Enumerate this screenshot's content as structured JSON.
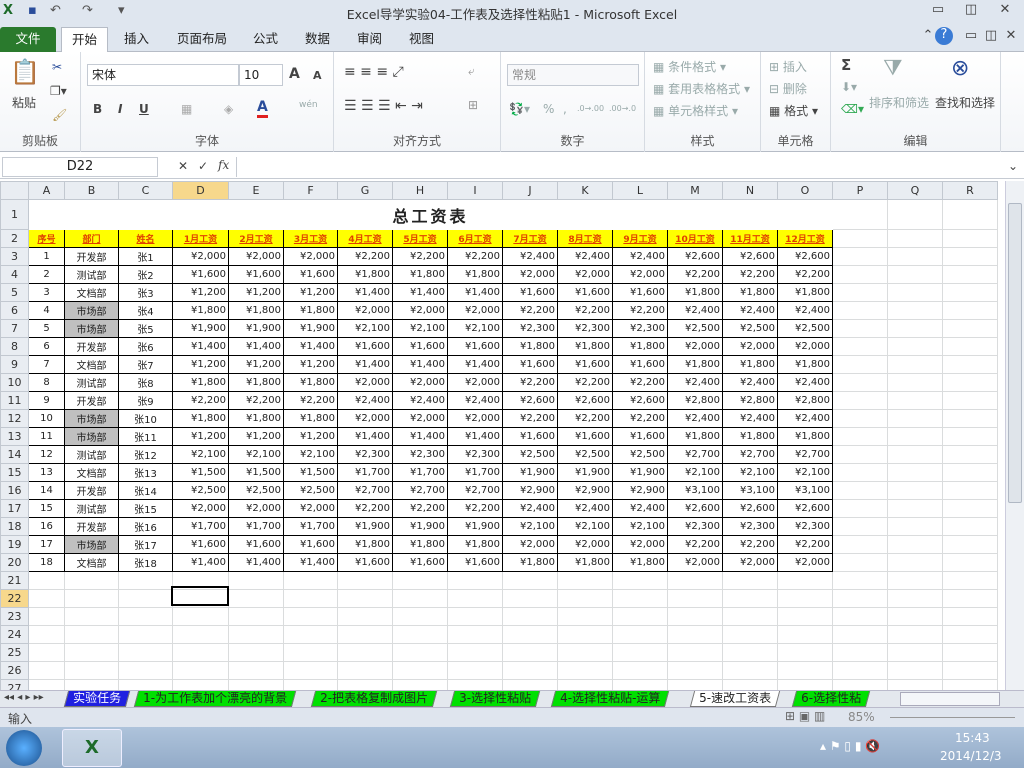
{
  "window": {
    "title": "Excel导学实验04-工作表及选择性粘贴1  -  Microsoft Excel",
    "minimize": "▭",
    "restore": "◫",
    "close": "✕"
  },
  "ribbon_tabs": [
    "文件",
    "开始",
    "插入",
    "页面布局",
    "公式",
    "数据",
    "审阅",
    "视图"
  ],
  "ribbon": {
    "clipboard": {
      "paste": "粘贴",
      "label": "剪贴板"
    },
    "font": {
      "name": "宋体",
      "size": "10",
      "bold": "B",
      "italic": "I",
      "underline": "U",
      "grow": "A",
      "shrink": "A",
      "color": "A",
      "phonetic": "wén",
      "label": "字体"
    },
    "align": {
      "label": "对齐方式"
    },
    "number": {
      "format": "常规",
      "percent": "%",
      "comma": ",",
      "inc": ".0→.00",
      "dec": ".00→.0",
      "label": "数字"
    },
    "styles": {
      "cond": "条件格式",
      "table": "套用表格格式",
      "cell": "单元格样式",
      "label": "样式"
    },
    "cells": {
      "insert": "插入",
      "delete": "删除",
      "format": "格式",
      "label": "单元格"
    },
    "editing": {
      "sum": "Σ",
      "sort": "排序和筛选",
      "find": "查找和选择",
      "label": "编辑"
    }
  },
  "formula_bar": {
    "name_box": "D22",
    "formula": "",
    "cancel": "✕",
    "enter": "✓",
    "fx": "fx"
  },
  "columns": [
    "A",
    "B",
    "C",
    "D",
    "E",
    "F",
    "G",
    "H",
    "I",
    "J",
    "K",
    "L",
    "M",
    "N",
    "O",
    "P",
    "Q",
    "R"
  ],
  "selected_cell": "D22",
  "sheet": {
    "title": "总工资表",
    "headers": [
      "序号",
      "部门",
      "姓名",
      "1月工资",
      "2月工资",
      "3月工资",
      "4月工资",
      "5月工资",
      "6月工资",
      "7月工资",
      "8月工资",
      "9月工资",
      "10月工资",
      "11月工资",
      "12月工资"
    ],
    "rows": [
      [
        "1",
        "开发部",
        "张1",
        "¥2,000",
        "¥2,000",
        "¥2,000",
        "¥2,200",
        "¥2,200",
        "¥2,200",
        "¥2,400",
        "¥2,400",
        "¥2,400",
        "¥2,600",
        "¥2,600",
        "¥2,600"
      ],
      [
        "2",
        "测试部",
        "张2",
        "¥1,600",
        "¥1,600",
        "¥1,600",
        "¥1,800",
        "¥1,800",
        "¥1,800",
        "¥2,000",
        "¥2,000",
        "¥2,000",
        "¥2,200",
        "¥2,200",
        "¥2,200"
      ],
      [
        "3",
        "文档部",
        "张3",
        "¥1,200",
        "¥1,200",
        "¥1,200",
        "¥1,400",
        "¥1,400",
        "¥1,400",
        "¥1,600",
        "¥1,600",
        "¥1,600",
        "¥1,800",
        "¥1,800",
        "¥1,800"
      ],
      [
        "4",
        "市场部",
        "张4",
        "¥1,800",
        "¥1,800",
        "¥1,800",
        "¥2,000",
        "¥2,000",
        "¥2,000",
        "¥2,200",
        "¥2,200",
        "¥2,200",
        "¥2,400",
        "¥2,400",
        "¥2,400"
      ],
      [
        "5",
        "市场部",
        "张5",
        "¥1,900",
        "¥1,900",
        "¥1,900",
        "¥2,100",
        "¥2,100",
        "¥2,100",
        "¥2,300",
        "¥2,300",
        "¥2,300",
        "¥2,500",
        "¥2,500",
        "¥2,500"
      ],
      [
        "6",
        "开发部",
        "张6",
        "¥1,400",
        "¥1,400",
        "¥1,400",
        "¥1,600",
        "¥1,600",
        "¥1,600",
        "¥1,800",
        "¥1,800",
        "¥1,800",
        "¥2,000",
        "¥2,000",
        "¥2,000"
      ],
      [
        "7",
        "文档部",
        "张7",
        "¥1,200",
        "¥1,200",
        "¥1,200",
        "¥1,400",
        "¥1,400",
        "¥1,400",
        "¥1,600",
        "¥1,600",
        "¥1,600",
        "¥1,800",
        "¥1,800",
        "¥1,800"
      ],
      [
        "8",
        "测试部",
        "张8",
        "¥1,800",
        "¥1,800",
        "¥1,800",
        "¥2,000",
        "¥2,000",
        "¥2,000",
        "¥2,200",
        "¥2,200",
        "¥2,200",
        "¥2,400",
        "¥2,400",
        "¥2,400"
      ],
      [
        "9",
        "开发部",
        "张9",
        "¥2,200",
        "¥2,200",
        "¥2,200",
        "¥2,400",
        "¥2,400",
        "¥2,400",
        "¥2,600",
        "¥2,600",
        "¥2,600",
        "¥2,800",
        "¥2,800",
        "¥2,800"
      ],
      [
        "10",
        "市场部",
        "张10",
        "¥1,800",
        "¥1,800",
        "¥1,800",
        "¥2,000",
        "¥2,000",
        "¥2,000",
        "¥2,200",
        "¥2,200",
        "¥2,200",
        "¥2,400",
        "¥2,400",
        "¥2,400"
      ],
      [
        "11",
        "市场部",
        "张11",
        "¥1,200",
        "¥1,200",
        "¥1,200",
        "¥1,400",
        "¥1,400",
        "¥1,400",
        "¥1,600",
        "¥1,600",
        "¥1,600",
        "¥1,800",
        "¥1,800",
        "¥1,800"
      ],
      [
        "12",
        "测试部",
        "张12",
        "¥2,100",
        "¥2,100",
        "¥2,100",
        "¥2,300",
        "¥2,300",
        "¥2,300",
        "¥2,500",
        "¥2,500",
        "¥2,500",
        "¥2,700",
        "¥2,700",
        "¥2,700"
      ],
      [
        "13",
        "文档部",
        "张13",
        "¥1,500",
        "¥1,500",
        "¥1,500",
        "¥1,700",
        "¥1,700",
        "¥1,700",
        "¥1,900",
        "¥1,900",
        "¥1,900",
        "¥2,100",
        "¥2,100",
        "¥2,100"
      ],
      [
        "14",
        "开发部",
        "张14",
        "¥2,500",
        "¥2,500",
        "¥2,500",
        "¥2,700",
        "¥2,700",
        "¥2,700",
        "¥2,900",
        "¥2,900",
        "¥2,900",
        "¥3,100",
        "¥3,100",
        "¥3,100"
      ],
      [
        "15",
        "测试部",
        "张15",
        "¥2,000",
        "¥2,000",
        "¥2,000",
        "¥2,200",
        "¥2,200",
        "¥2,200",
        "¥2,400",
        "¥2,400",
        "¥2,400",
        "¥2,600",
        "¥2,600",
        "¥2,600"
      ],
      [
        "16",
        "开发部",
        "张16",
        "¥1,700",
        "¥1,700",
        "¥1,700",
        "¥1,900",
        "¥1,900",
        "¥1,900",
        "¥2,100",
        "¥2,100",
        "¥2,100",
        "¥2,300",
        "¥2,300",
        "¥2,300"
      ],
      [
        "17",
        "市场部",
        "张17",
        "¥1,600",
        "¥1,600",
        "¥1,600",
        "¥1,800",
        "¥1,800",
        "¥1,800",
        "¥2,000",
        "¥2,000",
        "¥2,000",
        "¥2,200",
        "¥2,200",
        "¥2,200"
      ],
      [
        "18",
        "文档部",
        "张18",
        "¥1,400",
        "¥1,400",
        "¥1,400",
        "¥1,600",
        "¥1,600",
        "¥1,600",
        "¥1,800",
        "¥1,800",
        "¥1,800",
        "¥2,000",
        "¥2,000",
        "¥2,000"
      ]
    ],
    "total_rows": 27
  },
  "sheet_tabs": [
    {
      "label": "实验任务",
      "color": "#2020e0",
      "text": "#ffffff"
    },
    {
      "label": "1-为工作表加个漂亮的背景",
      "color": "#00e000",
      "text": "#222222"
    },
    {
      "label": "2-把表格复制成图片",
      "color": "#00e000",
      "text": "#222222"
    },
    {
      "label": "3-选择性粘贴",
      "color": "#00e000",
      "text": "#222222"
    },
    {
      "label": "4-选择性粘贴-运算",
      "color": "#00e000",
      "text": "#222222"
    },
    {
      "label": "5-速改工资表",
      "color": "#ffffff",
      "text": "#222222",
      "active": true
    },
    {
      "label": "6-选择性粘",
      "color": "#00e000",
      "text": "#222222"
    }
  ],
  "status": {
    "mode": "输入",
    "zoom": "85%"
  },
  "taskbar": {
    "time": "15:43",
    "date": "2014/12/3"
  }
}
